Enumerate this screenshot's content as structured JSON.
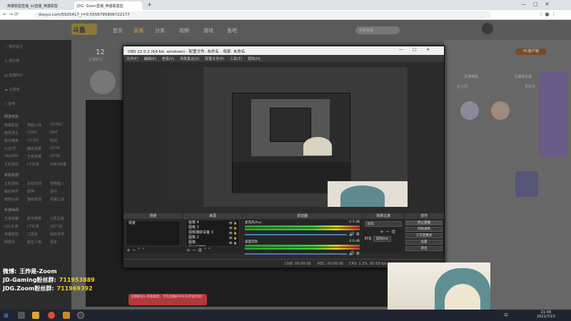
{
  "browser": {
    "tabs": [
      {
        "label": "英雄联盟直播_lol直播_英雄联盟"
      },
      {
        "label": "JDG- Zoom直播_英雄联盟直"
      }
    ],
    "new_tab": "+",
    "url": "douyu.com/5925417_r=0.5556795806722177"
  },
  "site": {
    "logo": "斗鱼",
    "nav": [
      "首页",
      "直播",
      "分类",
      "视频",
      "游戏",
      "鱼吧"
    ],
    "search_placeholder": "搜索直播",
    "follower_count": "12",
    "follower_label": "主播积分",
    "sidebar": [
      {
        "label": "我的关注",
        "icon": "heart-icon"
      },
      {
        "label": "排行榜",
        "icon": "trophy-icon"
      },
      {
        "label": "直播ROI",
        "icon": "chart-icon"
      },
      {
        "label": "云游戏",
        "icon": "cloud-icon"
      },
      {
        "label": "鱼吧",
        "icon": "fish-icon"
      }
    ],
    "sidebar_sections": [
      {
        "title": "网游竞技",
        "rows": [
          [
            "英雄联盟",
            "穿越火线",
            "DOTA2"
          ],
          [
            "绝地求生",
            "CSGO",
            "DNF"
          ],
          [
            "和平精英",
            "CS:GO",
            "吃鸡"
          ],
          [
            "lol云顶",
            "魔兽争霸",
            "DOTA"
          ],
          [
            "VALORA",
            "王者荣耀",
            "DOTA"
          ],
          [
            "主机游戏",
            "CF手游",
            "APEX英雄"
          ]
        ]
      },
      {
        "title": "单机热游",
        "rows": [
          [
            "主机游戏",
            "永劫无间",
            "怪物猎人"
          ],
          [
            "我的世界",
            "原神",
            "蛋仔"
          ],
          [
            "植物大战",
            "猫和老鼠",
            "风暴之战"
          ]
        ]
      },
      {
        "title": "手游休闲",
        "rows": [
          [
            "王者荣耀",
            "和平精英",
            "火影忍者"
          ],
          [
            "LOL手游",
            "CF手游",
            "QQ飞车"
          ],
          [
            "英雄联盟",
            "三国杀",
            "我的世界"
          ],
          [
            "阴阳师",
            "第五人格",
            "更多"
          ]
        ]
      }
    ],
    "pcu_badge": "PC客户端",
    "right_labels": [
      "主播等级",
      "主播成长值",
      "粉丝团",
      "贡献榜"
    ]
  },
  "obs": {
    "title": "OBS 22.0.2 (64-bit, windows) - 配置文件: 未命名 - 场景: 未命名",
    "window_controls": [
      "—",
      "□",
      "✕"
    ],
    "menu": [
      "文件(F)",
      "编辑(E)",
      "查看(V)",
      "场景集合(S)",
      "配置文件(P)",
      "工具(T)",
      "帮助(H)"
    ],
    "docks": {
      "scenes": {
        "title": "场景",
        "items": [
          "场景"
        ]
      },
      "sources": {
        "title": "来源",
        "items": [
          "图像 4",
          "图像 3",
          "视频捕获设备 3",
          "图像 2",
          "图像",
          "显示器捕获"
        ]
      },
      "mixer": {
        "title": "混音器",
        "channels": [
          {
            "name": "麦克风/Aux",
            "db": "-2.5 dB"
          },
          {
            "name": "桌面音频",
            "db": "0.0 dB"
          }
        ]
      },
      "transitions": {
        "title": "场景过渡",
        "type": "淡出",
        "duration_label": "时长",
        "duration": "300ms"
      },
      "controls": {
        "title": "控件",
        "buttons": [
          "停止直播",
          "开始录制",
          "工作室模式",
          "设置",
          "退出"
        ]
      }
    },
    "status": {
      "live": "LIVE: 00:00:00",
      "rec": "REC: 00:00:00",
      "cpu": "CPU: 1.3%, 60.00 fps"
    }
  },
  "overlay": {
    "lines": [
      {
        "label": "微博:",
        "value": "王炸是-Zoom",
        "color": "#ffffff"
      },
      {
        "label": "JD-Gaming粉丝群:",
        "value": "711953889",
        "color": "#f5d300"
      },
      {
        "label": "JDG.Zoom粉丝群:",
        "value": "711969392",
        "color": "#f5d300"
      }
    ],
    "notice": "主播要加入英雄联盟，可在直播间中天天参加活动！"
  },
  "taskbar": {
    "time": "21:58",
    "date": "2021/7/13",
    "lang": "中"
  }
}
